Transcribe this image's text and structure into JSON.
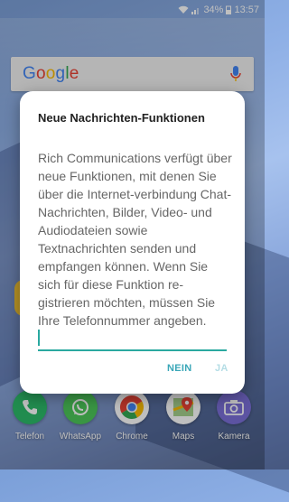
{
  "statusbar": {
    "battery": "34%",
    "time": "13:57"
  },
  "search": {
    "logo": "Google"
  },
  "dialog": {
    "title": "Neue Nachrichten-Funktionen",
    "body": "Rich Communications verfügt über neue Funktionen, mit denen Sie über die Internet-verbindung Chat-Nachrichten, Bilder, Video- und Audiodateien sowie Textnachrichten senden und empfangen können. Wenn Sie sich für diese Funktion re-gistrieren möchten, müssen Sie Ihre Telefonnummer angeben.",
    "input_value": "",
    "no_label": "NEIN",
    "yes_label": "JA"
  },
  "dock": {
    "apps": [
      {
        "label": "Telefon",
        "icon": "phone-icon",
        "color": "#2dbb6a"
      },
      {
        "label": "WhatsApp",
        "icon": "whatsapp-icon",
        "color": "#4cc75a"
      },
      {
        "label": "Chrome",
        "icon": "chrome-icon",
        "color": "#ffffff"
      },
      {
        "label": "Maps",
        "icon": "maps-icon",
        "color": "#ffffff"
      },
      {
        "label": "Kamera",
        "icon": "camera-icon",
        "color": "#7b6fd8"
      }
    ]
  },
  "colors": {
    "accent": "#2aa9a0",
    "button_text": "#3aa7b8",
    "button_disabled": "#b4dde5"
  }
}
